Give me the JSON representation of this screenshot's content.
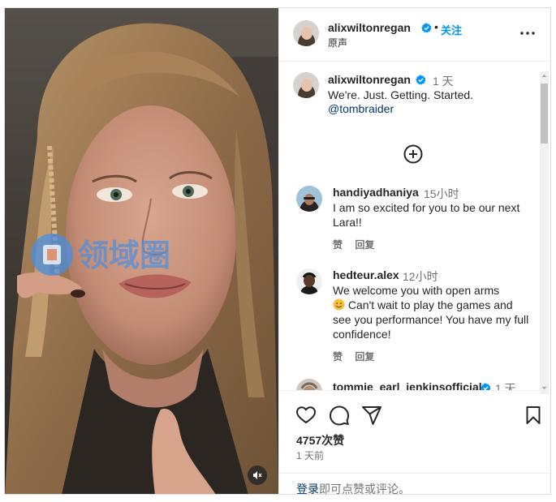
{
  "post": {
    "username": "alixwiltonregan",
    "follow_label": "关注",
    "separator": "•",
    "audio_label": "原声",
    "caption": {
      "username": "alixwiltonregan",
      "time": "1 天",
      "text": "We're. Just. Getting. Started.",
      "mention": "@tombraider"
    },
    "watermark_text": "领域圈"
  },
  "comments": [
    {
      "username": "handiyadhaniya",
      "time": "15小时",
      "text": "I am so excited for you to be our next Lara!!",
      "like_label": "赞",
      "reply_label": "回复"
    },
    {
      "username": "hedteur.alex",
      "time": "12小时",
      "text_before_emoji": "We welcome you with open arms",
      "emoji": "smiling-face-emoji",
      "text_after_emoji": " Can't wait to play the games and see you performance! You have my full confidence!",
      "like_label": "赞",
      "reply_label": "回复"
    },
    {
      "username": "tommie_earl_jenkinsofficial",
      "time": "1 天"
    }
  ],
  "footer": {
    "likes": "4757次赞",
    "posted": "1 天前",
    "login_link": "登录",
    "login_rest": "即可点赞或评论。"
  },
  "icons": {
    "like": "heart-icon",
    "comment": "comment-bubble-icon",
    "share": "paper-plane-icon",
    "save": "bookmark-icon",
    "more": "more-options-icon",
    "load_more": "plus-circle-icon",
    "mute": "speaker-muted-icon",
    "verified": "verified-badge-icon"
  },
  "colors": {
    "link": "#0095f6",
    "mention": "#00376b",
    "verified": "#0095f6",
    "muted_text": "#737373"
  }
}
